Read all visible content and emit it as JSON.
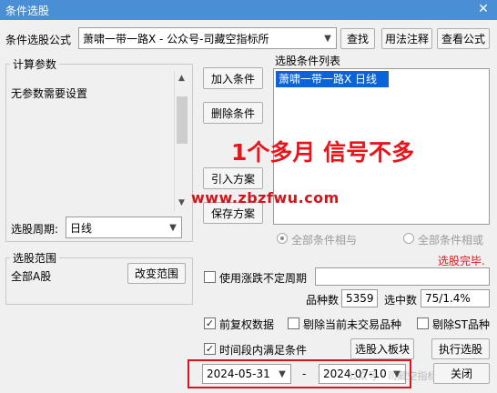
{
  "window": {
    "title": "条件选股",
    "close_glyph": "✕"
  },
  "formula_row": {
    "label": "条件选股公式",
    "value": "萧啸一带一路X  -  公众号-司藏空指标所",
    "find_button": "查找",
    "usage_button": "用法注释",
    "view_button": "查看公式"
  },
  "params": {
    "legend": "计算参数",
    "message": "无参数需要设置",
    "period_label": "选股周期:",
    "period_value": "日线"
  },
  "actions": {
    "add_condition": "加入条件",
    "delete_condition": "删除条件",
    "import_scheme": "引入方案",
    "save_scheme": "保存方案"
  },
  "conditions": {
    "legend": "选股条件列表",
    "items": [
      "萧啸一带一路X  日线"
    ],
    "selected_color": "#0a64d8"
  },
  "overlay": {
    "promo_text": "1个多月 信号不多",
    "promo_color": "#e8141c",
    "watermark_url": "www.zbzfwu.com",
    "watermark_color": "#d4141c"
  },
  "logic": {
    "and_label": "全部条件相与",
    "or_label": "全部条件相或"
  },
  "status": {
    "text": "选股完毕.",
    "color": "#e8141c"
  },
  "range": {
    "legend": "选股范围",
    "value": "全部A股",
    "change_button": "改变范围"
  },
  "options": {
    "uncertain_period_label": "使用涨跌不定周期",
    "uncertain_period_checked": false,
    "variety_count_label": "品种数",
    "variety_count": "5359",
    "selected_count_label": "选中数",
    "selected_count": "75/1.4%",
    "adjusted_label": "前复权数据",
    "adjusted_checked": true,
    "exclude_untraded_label": "剔除当前未交易品种",
    "exclude_untraded_checked": false,
    "exclude_st_label": "剔除ST品种",
    "exclude_st_checked": false,
    "time_condition_label": "时间段内满足条件",
    "time_condition_checked": true,
    "start_date": "2024-05-31",
    "date_separator": "-",
    "end_date": "2024-07-10",
    "check_glyph": "✓"
  },
  "footer": {
    "to_block_button": "选股入板块",
    "run_button": "执行选股",
    "close_button": "关闭",
    "watermark": "公众号 · 司藏空指标所"
  },
  "highlight_color": "#d9141c"
}
